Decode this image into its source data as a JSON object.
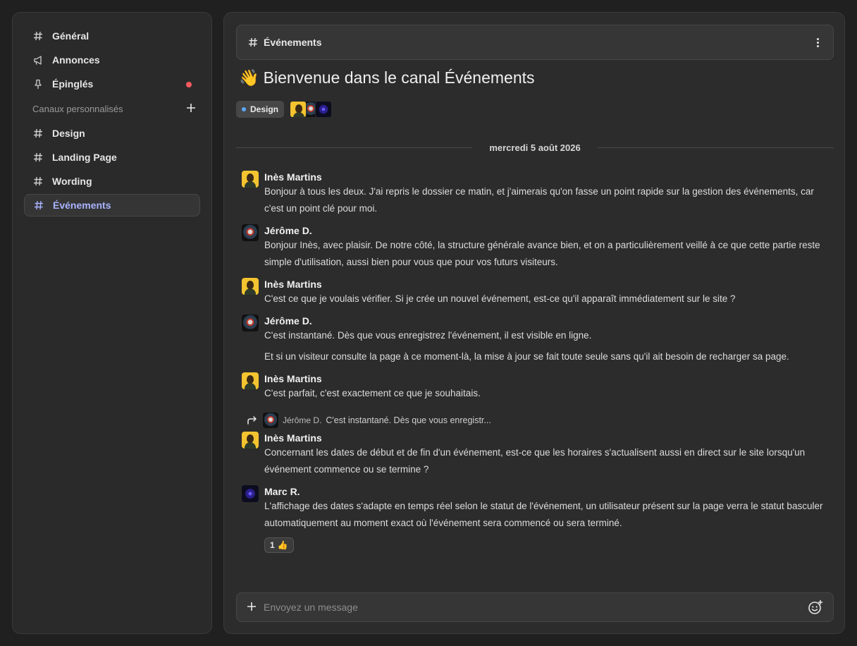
{
  "sidebar": {
    "top_items": [
      {
        "label": "Général",
        "icon": "hash-icon"
      },
      {
        "label": "Annonces",
        "icon": "megaphone-icon"
      },
      {
        "label": "Épinglés",
        "icon": "pin-icon",
        "unread": true
      }
    ],
    "custom_section_label": "Canaux personnalisés",
    "custom_items": [
      {
        "label": "Design"
      },
      {
        "label": "Landing Page"
      },
      {
        "label": "Wording"
      },
      {
        "label": "Événements",
        "active": true
      }
    ]
  },
  "channel": {
    "name": "Événements",
    "welcome_emoji": "👋",
    "welcome_text": "Bienvenue dans le canal Événements",
    "tag": "Design",
    "date_divider": "mercredi 5 août 2026"
  },
  "messages": [
    {
      "author": "Inès Martins",
      "avatar": "ines",
      "lines": [
        "Bonjour à tous les deux. J'ai repris le dossier ce matin, et j'aimerais qu'on fasse un point rapide sur la gestion des événements, car c'est un point clé pour moi."
      ]
    },
    {
      "author": "Jérôme D.",
      "avatar": "jerome",
      "lines": [
        "Bonjour Inès, avec plaisir. De notre côté, la structure générale avance bien, et on a particulièrement veillé à ce que cette partie reste simple d'utilisation, aussi bien pour vous que pour vos futurs visiteurs."
      ]
    },
    {
      "author": "Inès Martins",
      "avatar": "ines",
      "lines": [
        "C'est ce que je voulais vérifier. Si je crée un nouvel événement, est-ce qu'il apparaît immédiatement sur le site ?"
      ]
    },
    {
      "author": "Jérôme D.",
      "avatar": "jerome",
      "lines": [
        "C'est instantané. Dès que vous enregistrez l'événement, il est visible en ligne.",
        "Et si un visiteur consulte la page à ce moment-là, la mise à jour se fait toute seule sans qu'il ait besoin de recharger sa page."
      ]
    },
    {
      "author": "Inès Martins",
      "avatar": "ines",
      "lines": [
        "C'est parfait, c'est exactement ce que je souhaitais."
      ]
    }
  ],
  "reply": {
    "author": "Jérôme D.",
    "snippet": "C'est instantané. Dès que vous enregistr..."
  },
  "messages_after": [
    {
      "author": "Inès Martins",
      "avatar": "ines",
      "lines": [
        "Concernant les dates de début et de fin d'un événement, est-ce que les horaires s'actualisent aussi en direct sur le site lorsqu'un événement commence ou se termine ?"
      ]
    },
    {
      "author": "Marc R.",
      "avatar": "marc",
      "lines": [
        "L'affichage des dates s'adapte en temps réel selon le statut de l'événement, un utilisateur présent sur la page verra le statut basculer automatiquement au moment exact où l'événement sera commencé ou sera terminé."
      ],
      "reaction": {
        "count": "1",
        "emoji": "👍"
      }
    }
  ],
  "composer": {
    "placeholder": "Envoyez un message"
  }
}
